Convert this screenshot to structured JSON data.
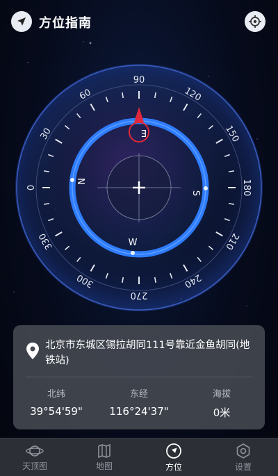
{
  "header": {
    "title": "方位指南"
  },
  "compass": {
    "degree_labels": [
      "0",
      "30",
      "60",
      "90",
      "120",
      "150",
      "180",
      "210",
      "240",
      "270",
      "300",
      "330"
    ],
    "cardinals": {
      "north": "N",
      "east": "E",
      "south": "S",
      "west": "W"
    }
  },
  "location": {
    "address": "北京市东城区锡拉胡同111号靠近金鱼胡同(地铁站)",
    "latitude_label": "北纬",
    "latitude": "39°54'59\"",
    "longitude_label": "东经",
    "longitude": "116°24'37\"",
    "altitude_label": "海拔",
    "altitude": "0米"
  },
  "nav": {
    "tabs": [
      {
        "label": "天顶图",
        "icon": "planet-icon",
        "active": false
      },
      {
        "label": "地图",
        "icon": "map-icon",
        "active": false
      },
      {
        "label": "方位",
        "icon": "compass-nav-icon",
        "active": true
      },
      {
        "label": "设置",
        "icon": "settings-icon",
        "active": false
      }
    ]
  },
  "colors": {
    "accent": "#2f7dff",
    "pointer": "#e0283a"
  }
}
